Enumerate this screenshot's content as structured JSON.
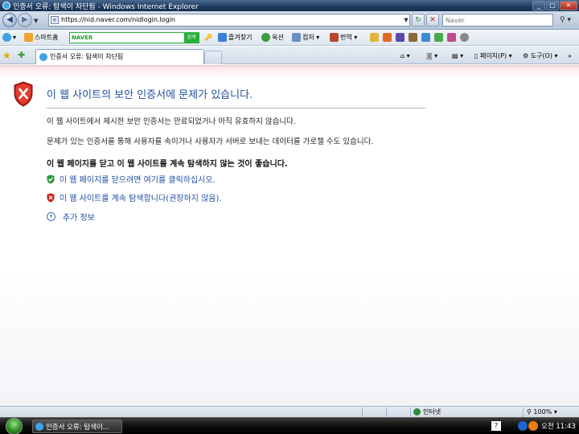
{
  "window": {
    "title": "인증서 오류: 탐색이 차단됨 - Windows Internet Explorer",
    "minimize": "_",
    "maximize": "□",
    "close": "✕"
  },
  "address_bar": {
    "url": "https://nid.naver.com/nidlogin.login",
    "search_placeholder": "Naver"
  },
  "toolbar": {
    "smart_home": "스마트홈",
    "naver_logo": "NAVER",
    "naver_search_btn": "검색",
    "favorites": "즐겨찾기",
    "options": "옥션",
    "hanjae": "컴처",
    "translate": "번역"
  },
  "tab": {
    "label": "인증서 오류: 탐색이 차단됨"
  },
  "command_bar": {
    "page": "페이지(P)",
    "tools": "도구(O)"
  },
  "content": {
    "title": "이 웹 사이트의 보안 인증서에 문제가 있습니다.",
    "para1": "이 웹 사이트에서 제시한 보안 인증서는 만료되었거나 아직 유효하지 않습니다.",
    "para2": "문제가 있는 인증서를 통해 사용자를 속이거나 사용자가 서버로 보내는 데이터를 가로챌 수도 있습니다.",
    "recommendation": "이 웹 페이지를 닫고 이 웹 사이트를 계속 탐색하지 않는 것이 좋습니다.",
    "close_link": "이 웹 페이지를 닫으려면 여기를 클릭하십시오.",
    "continue_link": "이 웹 사이트를 계속 탐색합니다(권장하지 않음).",
    "more_info": "추가 정보"
  },
  "status_bar": {
    "zone": "인터넷",
    "zoom": "100%"
  },
  "taskbar": {
    "task_label": "인증서 오류: 탐색이...",
    "lang_indicator": "?",
    "clock": "오전 11:43"
  }
}
